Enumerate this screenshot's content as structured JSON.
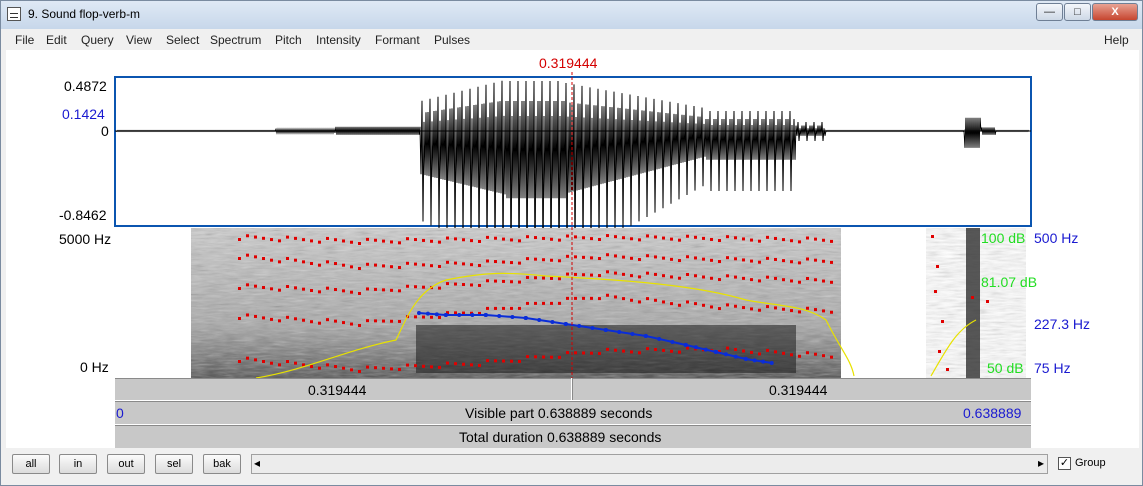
{
  "window": {
    "title": "9. Sound flop-verb-m"
  },
  "window_controls": {
    "minimize": "—",
    "maximize": "□",
    "close": "X"
  },
  "menu": {
    "items": [
      "File",
      "Edit",
      "Query",
      "View",
      "Select",
      "Spectrum",
      "Pitch",
      "Intensity",
      "Formant",
      "Pulses"
    ],
    "help": "Help"
  },
  "cursor": {
    "time_label": "0.319444"
  },
  "waveform": {
    "y_max": "0.4872",
    "y_cursor": "0.1424",
    "y_zero": "0",
    "y_min": "-0.8462"
  },
  "spectrogram": {
    "freq_max": "5000 Hz",
    "freq_min": "0 Hz",
    "intensity_max": "100 dB",
    "intensity_cursor": "81.07 dB",
    "intensity_min": "50 dB",
    "pitch_max": "500 Hz",
    "pitch_cursor": "227.3 Hz",
    "pitch_min": "75 Hz"
  },
  "time_bars": {
    "left_interval": "0.319444",
    "right_interval": "0.319444",
    "visible_start": "0",
    "visible_label": "Visible part 0.638889 seconds",
    "visible_end": "0.638889",
    "total_label": "Total duration 0.638889 seconds"
  },
  "toolbar": {
    "buttons": [
      "all",
      "in",
      "out",
      "sel",
      "bak"
    ],
    "scroll_left": "◂",
    "scroll_right": "▸",
    "group_label": "Group",
    "group_checked": true
  },
  "colors": {
    "cursor": "#d40000",
    "pitch": "#0a2dd8",
    "intensity": "#e8e200",
    "formant": "#e00000",
    "label_blue": "#1a1ad0",
    "label_green": "#22dd22"
  }
}
